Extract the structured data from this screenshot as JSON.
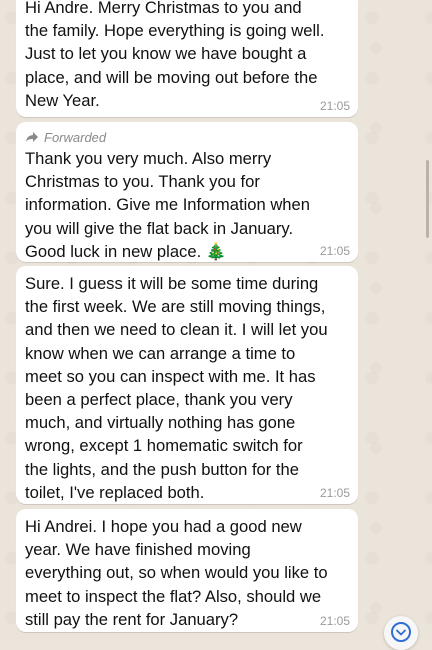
{
  "messages": [
    {
      "text": "Hi Andre. Merry Christmas to you and\nthe family. Hope everything is going well.\nJust to let you know we have bought a\nplace, and will be moving out before the\nNew Year.",
      "time": "21:05"
    },
    {
      "forwarded_label": "Forwarded",
      "text": "Thank you very much. Also merry\nChristmas to you. Thank you for\ninformation. Give me Information when\nyou will give the flat back in January.\nGood luck in new place. 🎄",
      "time": "21:05"
    },
    {
      "text": "Sure. I guess it will be some time during\nthe first week. We are still moving things,\nand then we need to clean it. I will let you\nknow when we can arrange a time to\nmeet so you can inspect with me. It has\nbeen a perfect place, thank you very\nmuch, and virtually nothing has gone\nwrong, except 1 homematic switch for\nthe lights, and the push button for the\ntoilet, I've replaced both.",
      "time": "21:05"
    },
    {
      "text": "Hi Andrei. I hope you had a good new\nyear. We have finished moving\neverything out, so when would you like to\nmeet to inspect the flat? Also, should we\nstill pay the rent for January?",
      "time": "21:05"
    }
  ],
  "icons": {
    "forward": "forward-arrow-icon",
    "scroll_down": "chevron-down-icon"
  },
  "colors": {
    "bubble": "#ffffff",
    "wallpaper": "#ebe4da",
    "timestamp": "#9a9a9a",
    "accent": "#2f6fd1"
  }
}
